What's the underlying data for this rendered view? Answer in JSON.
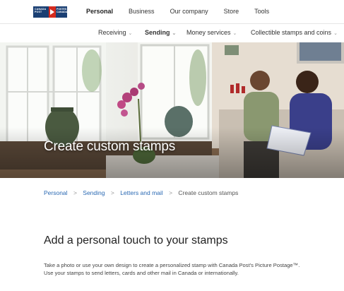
{
  "logo": {
    "line1": "CANADA",
    "line2": "POST",
    "line3": "POSTES",
    "line4": "CANADA",
    "colors": {
      "blue": "#1a3f73",
      "red": "#d52b1e"
    }
  },
  "topnav": {
    "items": [
      "Personal",
      "Business",
      "Our company",
      "Store",
      "Tools"
    ]
  },
  "subnav": {
    "items": [
      "Receiving",
      "Sending",
      "Money services",
      "Collectible stamps and coins"
    ],
    "chevron_icon": "chevron-down-icon"
  },
  "hero": {
    "title": "Create custom stamps"
  },
  "breadcrumb": {
    "items": [
      "Personal",
      "Sending",
      "Letters and mail",
      "Create custom stamps"
    ],
    "separator": ">"
  },
  "main": {
    "heading": "Add a personal touch to your stamps",
    "description": "Take a photo or use your own design to create a personalized stamp with Canada Post's Picture Postage™. Use your stamps to send letters, cards and other mail in Canada or internationally."
  }
}
